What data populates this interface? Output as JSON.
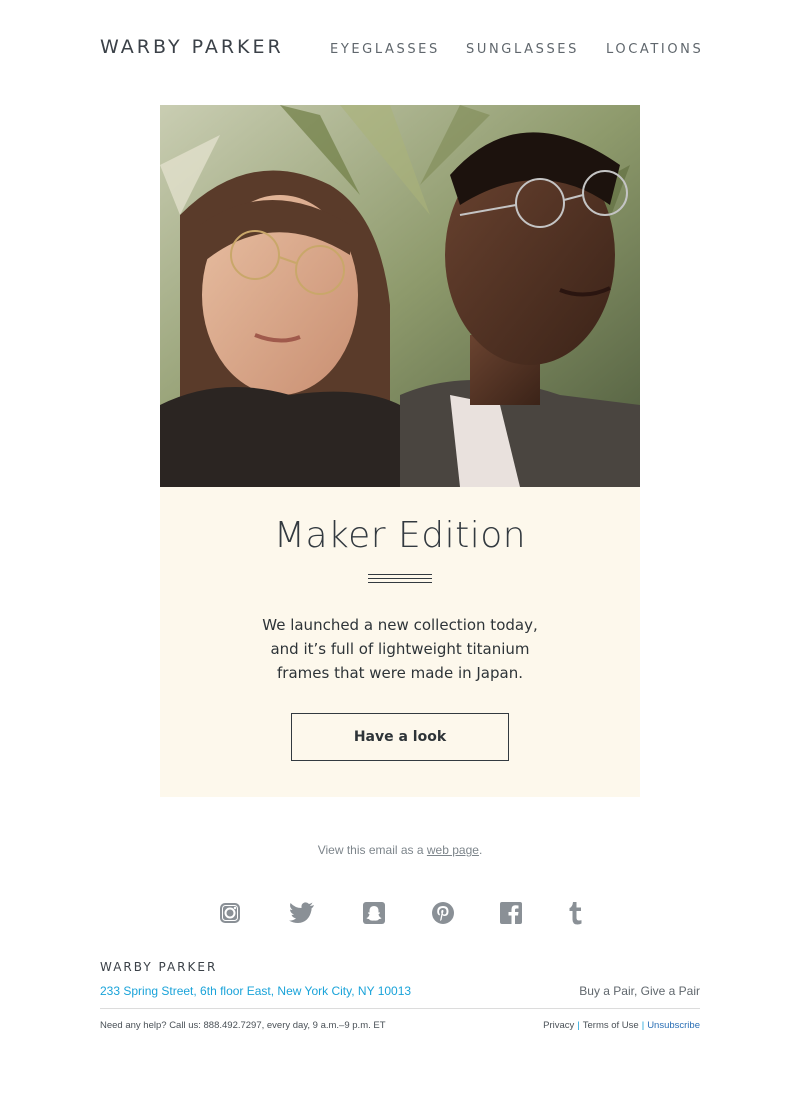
{
  "header": {
    "logo": "WARBY PARKER",
    "nav": [
      "EYEGLASSES",
      "SUNGLASSES",
      "LOCATIONS"
    ]
  },
  "hero": {
    "image_alt_icon": "hero-photo",
    "headline": "Maker Edition",
    "body_lines": [
      "We launched a new collection today,",
      "and it’s full of lightweight titanium",
      "frames that were made in Japan."
    ],
    "cta_label": "Have a look"
  },
  "webview": {
    "prefix": "View this email as a ",
    "link": "web page",
    "suffix": "."
  },
  "social": [
    "instagram-icon",
    "twitter-icon",
    "snapchat-icon",
    "pinterest-icon",
    "facebook-icon",
    "tumblr-icon"
  ],
  "footer": {
    "logo": "WARBY PARKER",
    "address": "233 Spring Street, 6th floor East, New York City, NY 10013",
    "tagline": "Buy a Pair, Give a Pair",
    "help": "Need any help? Call us: 888.492.7297, every day, 9 a.m.–9 p.m. ET",
    "legal": [
      "Privacy",
      "Terms of Use",
      "Unsubscribe"
    ]
  },
  "colors": {
    "text_dark": "#333a40",
    "nav_gray": "#60676d",
    "panel_bg": "#fdf8ec",
    "link_blue": "#1aa3d9",
    "icon_gray": "#8a9096"
  }
}
